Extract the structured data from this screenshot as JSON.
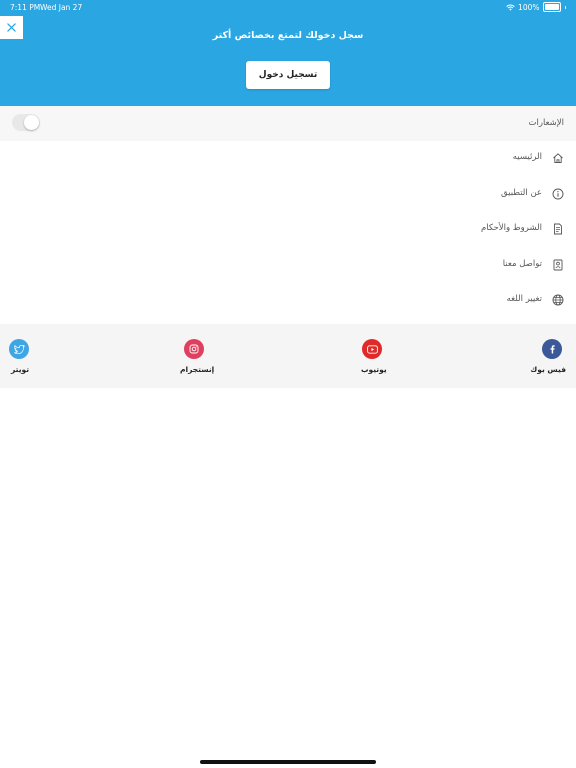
{
  "status_bar": {
    "time": "7:11 PM",
    "date": "Wed Jan 27",
    "battery_text": "100%",
    "battery_level": 1.0
  },
  "header": {
    "background": "#2aa6e2",
    "title": "سجل دخولك لتمتع بخصائص أكتر",
    "login_label": "تسجيل دخول",
    "close_icon": "close-icon"
  },
  "notifications": {
    "label": "الإشعارات",
    "enabled": false
  },
  "menu": {
    "items": [
      {
        "label": "الرئيسيه",
        "icon": "home-icon"
      },
      {
        "label": "عن التطبيق",
        "icon": "info-icon"
      },
      {
        "label": "الشروط والأحكام",
        "icon": "document-icon"
      },
      {
        "label": "تواصل معنا",
        "icon": "contact-card-icon"
      },
      {
        "label": "تغيير اللغه",
        "icon": "globe-icon"
      }
    ]
  },
  "social": {
    "items": [
      {
        "label": "فيس بوك",
        "icon": "facebook-icon",
        "color": "#3b5998"
      },
      {
        "label": "يوتيوب",
        "icon": "youtube-icon",
        "color": "#e02a2a"
      },
      {
        "label": "إنستجرام",
        "icon": "instagram-icon",
        "color": "#e0405f"
      },
      {
        "label": "تويتر",
        "icon": "twitter-icon",
        "color": "#3fa6e6"
      }
    ]
  }
}
